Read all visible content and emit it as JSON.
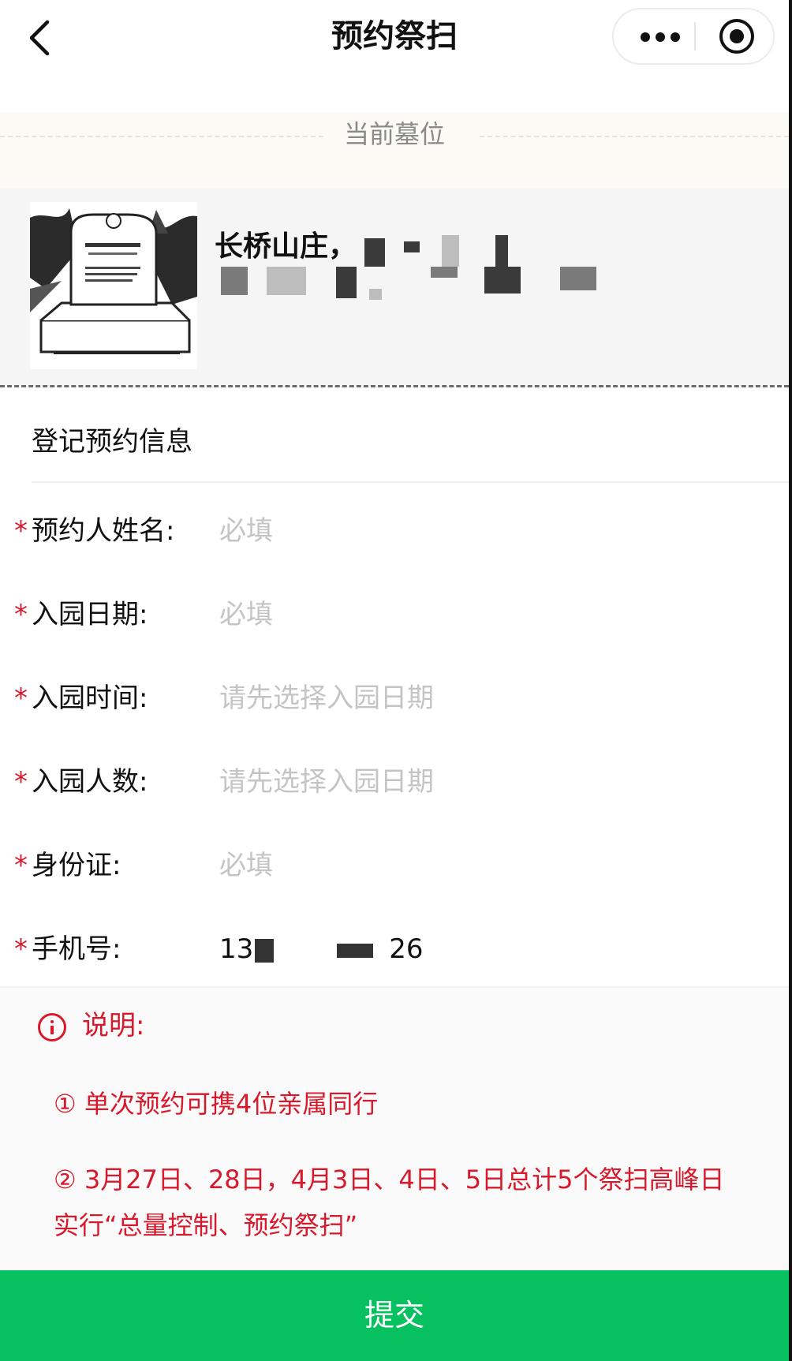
{
  "nav": {
    "title": "预约祭扫",
    "back_icon": "chevron-left-icon",
    "more_icon": "more-dots-icon",
    "close_icon": "target-icon"
  },
  "grave_section": {
    "heading": "当前墓位",
    "cemetery_name": "长桥山庄，",
    "image_icon": "tombstone-image"
  },
  "form": {
    "title": "登记预约信息",
    "required_mark": "*",
    "fields": [
      {
        "label": "预约人姓名:",
        "value": "必填"
      },
      {
        "label": "入园日期:",
        "value": "必填"
      },
      {
        "label": "入园时间:",
        "value": "请先选择入园日期"
      },
      {
        "label": "入园人数:",
        "value": "请先选择入园日期"
      },
      {
        "label": "身份证:",
        "value": "必填"
      },
      {
        "label": "手机号:",
        "value_prefix": "13",
        "value_suffix": "26"
      }
    ]
  },
  "notice": {
    "title": "说明:",
    "icon": "info-icon",
    "items": [
      "① 单次预约可携4位亲属同行",
      "② 3月27日、28日，4月3日、4日、5日总计5个祭扫高峰日",
      "实行“总量控制、预约祭扫”"
    ]
  },
  "submit": {
    "label": "提交",
    "color": "#07c160"
  },
  "colors": {
    "required": "#d8192c",
    "placeholder": "#c4c4c4"
  }
}
